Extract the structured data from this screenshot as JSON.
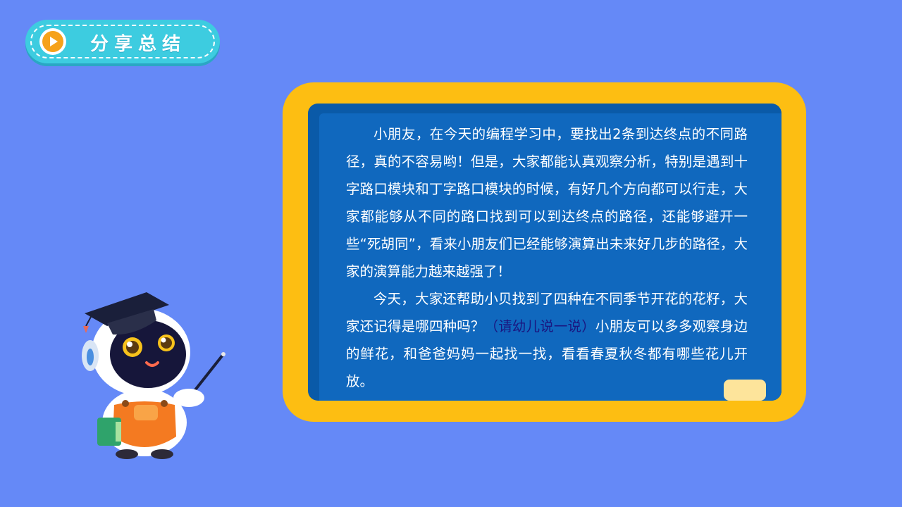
{
  "header": {
    "title": "分享总结",
    "icon": "play-icon"
  },
  "board": {
    "paragraph1": "小朋友，在今天的编程学习中，要找出2条到达终点的不同路径，真的不容易哟！但是，大家都能认真观察分析，特别是遇到十字路口模块和丁字路口模块的时候，有好几个方向都可以行走，大家都能够从不同的路口找到可以到达终点的路径，还能够避开一些“死胡同”，看来小朋友们已经能够演算出未来好几步的路径，大家的演算能力越来越强了！",
    "paragraph2_before": "今天，大家还帮助小贝找到了四种在不同季节开花的花籽，大家还记得是哪四种吗？",
    "paragraph2_hint": "（请幼儿说一说）",
    "paragraph2_after": "小朋友可以多多观察身边的鲜花，和爸爸妈妈一起找一找，看看春夏秋冬都有哪些花儿开放。"
  },
  "colors": {
    "background": "#6589F7",
    "title_pill": "#3DCCE0",
    "board_frame": "#FDBE12",
    "board": "#1068BE",
    "hint_text": "#1A1680"
  }
}
